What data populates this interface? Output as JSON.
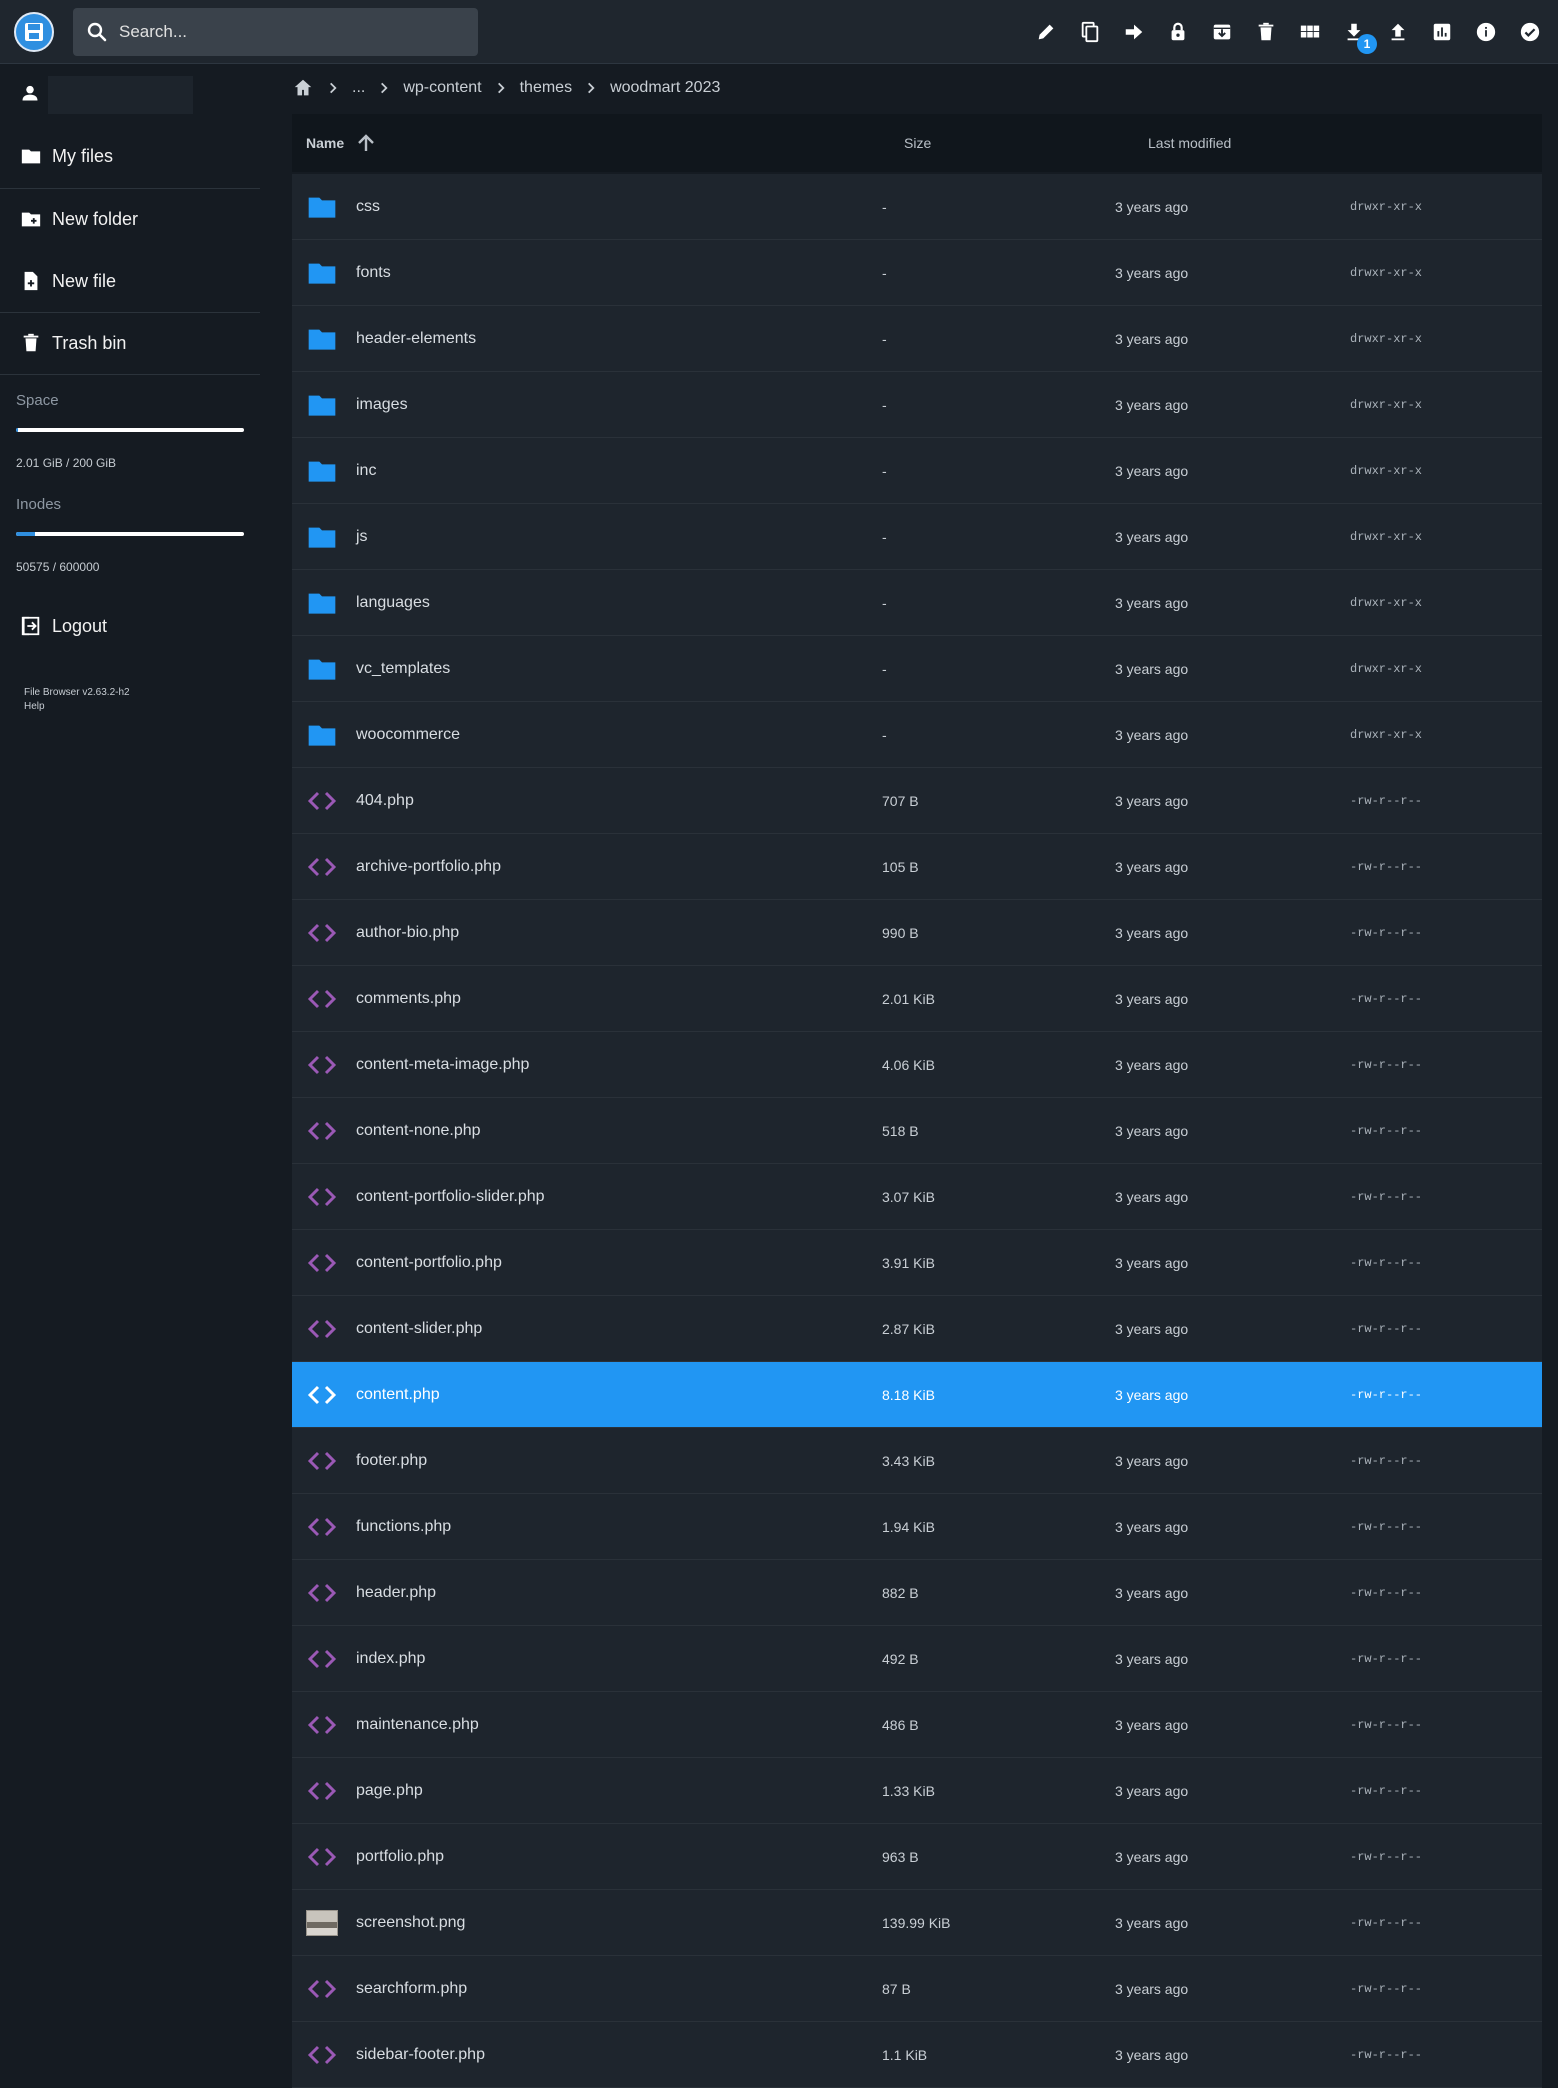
{
  "header": {
    "search_placeholder": "Search...",
    "download_badge": "1",
    "actions": [
      {
        "name": "edit-icon"
      },
      {
        "name": "copy-icon"
      },
      {
        "name": "move-icon"
      },
      {
        "name": "lock-icon"
      },
      {
        "name": "archive-icon"
      },
      {
        "name": "delete-icon"
      },
      {
        "name": "grid-view-icon"
      },
      {
        "name": "download-icon"
      },
      {
        "name": "upload-icon"
      },
      {
        "name": "info-chart-icon"
      },
      {
        "name": "info-icon"
      },
      {
        "name": "select-all-icon"
      }
    ]
  },
  "sidebar": {
    "my_files": "My files",
    "new_folder": "New folder",
    "new_file": "New file",
    "trash_bin": "Trash bin",
    "space_label": "Space",
    "space_text": "2.01 GiB / 200 GiB",
    "space_fraction": 0.01,
    "inodes_label": "Inodes",
    "inodes_text": "50575 / 600000",
    "inodes_fraction": 0.084,
    "logout": "Logout",
    "version": "File Browser v2.63.2-h2",
    "help": "Help"
  },
  "breadcrumb": {
    "ellipsis": "...",
    "items": [
      "wp-content",
      "themes",
      "woodmart 2023"
    ]
  },
  "list_header": {
    "name": "Name",
    "size": "Size",
    "modified": "Last modified"
  },
  "files": [
    {
      "name": "css",
      "type": "folder",
      "size": "-",
      "modified": "3 years ago",
      "perm": "drwxr-xr-x"
    },
    {
      "name": "fonts",
      "type": "folder",
      "size": "-",
      "modified": "3 years ago",
      "perm": "drwxr-xr-x"
    },
    {
      "name": "header-elements",
      "type": "folder",
      "size": "-",
      "modified": "3 years ago",
      "perm": "drwxr-xr-x"
    },
    {
      "name": "images",
      "type": "folder",
      "size": "-",
      "modified": "3 years ago",
      "perm": "drwxr-xr-x"
    },
    {
      "name": "inc",
      "type": "folder",
      "size": "-",
      "modified": "3 years ago",
      "perm": "drwxr-xr-x"
    },
    {
      "name": "js",
      "type": "folder",
      "size": "-",
      "modified": "3 years ago",
      "perm": "drwxr-xr-x"
    },
    {
      "name": "languages",
      "type": "folder",
      "size": "-",
      "modified": "3 years ago",
      "perm": "drwxr-xr-x"
    },
    {
      "name": "vc_templates",
      "type": "folder",
      "size": "-",
      "modified": "3 years ago",
      "perm": "drwxr-xr-x"
    },
    {
      "name": "woocommerce",
      "type": "folder",
      "size": "-",
      "modified": "3 years ago",
      "perm": "drwxr-xr-x"
    },
    {
      "name": "404.php",
      "type": "code",
      "size": "707 B",
      "modified": "3 years ago",
      "perm": "-rw-r--r--"
    },
    {
      "name": "archive-portfolio.php",
      "type": "code",
      "size": "105 B",
      "modified": "3 years ago",
      "perm": "-rw-r--r--"
    },
    {
      "name": "author-bio.php",
      "type": "code",
      "size": "990 B",
      "modified": "3 years ago",
      "perm": "-rw-r--r--"
    },
    {
      "name": "comments.php",
      "type": "code",
      "size": "2.01 KiB",
      "modified": "3 years ago",
      "perm": "-rw-r--r--"
    },
    {
      "name": "content-meta-image.php",
      "type": "code",
      "size": "4.06 KiB",
      "modified": "3 years ago",
      "perm": "-rw-r--r--"
    },
    {
      "name": "content-none.php",
      "type": "code",
      "size": "518 B",
      "modified": "3 years ago",
      "perm": "-rw-r--r--"
    },
    {
      "name": "content-portfolio-slider.php",
      "type": "code",
      "size": "3.07 KiB",
      "modified": "3 years ago",
      "perm": "-rw-r--r--"
    },
    {
      "name": "content-portfolio.php",
      "type": "code",
      "size": "3.91 KiB",
      "modified": "3 years ago",
      "perm": "-rw-r--r--"
    },
    {
      "name": "content-slider.php",
      "type": "code",
      "size": "2.87 KiB",
      "modified": "3 years ago",
      "perm": "-rw-r--r--"
    },
    {
      "name": "content.php",
      "type": "code",
      "size": "8.18 KiB",
      "modified": "3 years ago",
      "perm": "-rw-r--r--",
      "selected": true
    },
    {
      "name": "footer.php",
      "type": "code",
      "size": "3.43 KiB",
      "modified": "3 years ago",
      "perm": "-rw-r--r--"
    },
    {
      "name": "functions.php",
      "type": "code",
      "size": "1.94 KiB",
      "modified": "3 years ago",
      "perm": "-rw-r--r--"
    },
    {
      "name": "header.php",
      "type": "code",
      "size": "882 B",
      "modified": "3 years ago",
      "perm": "-rw-r--r--"
    },
    {
      "name": "index.php",
      "type": "code",
      "size": "492 B",
      "modified": "3 years ago",
      "perm": "-rw-r--r--"
    },
    {
      "name": "maintenance.php",
      "type": "code",
      "size": "486 B",
      "modified": "3 years ago",
      "perm": "-rw-r--r--"
    },
    {
      "name": "page.php",
      "type": "code",
      "size": "1.33 KiB",
      "modified": "3 years ago",
      "perm": "-rw-r--r--"
    },
    {
      "name": "portfolio.php",
      "type": "code",
      "size": "963 B",
      "modified": "3 years ago",
      "perm": "-rw-r--r--"
    },
    {
      "name": "screenshot.png",
      "type": "image",
      "size": "139.99 KiB",
      "modified": "3 years ago",
      "perm": "-rw-r--r--"
    },
    {
      "name": "searchform.php",
      "type": "code",
      "size": "87 B",
      "modified": "3 years ago",
      "perm": "-rw-r--r--"
    },
    {
      "name": "sidebar-footer.php",
      "type": "code",
      "size": "1.1 KiB",
      "modified": "3 years ago",
      "perm": "-rw-r--r--"
    }
  ],
  "colors": {
    "accent": "#2196f3",
    "folder": "#2196f3",
    "code": "#9b59b6",
    "background": "#151b22",
    "row": "#1e252d"
  }
}
